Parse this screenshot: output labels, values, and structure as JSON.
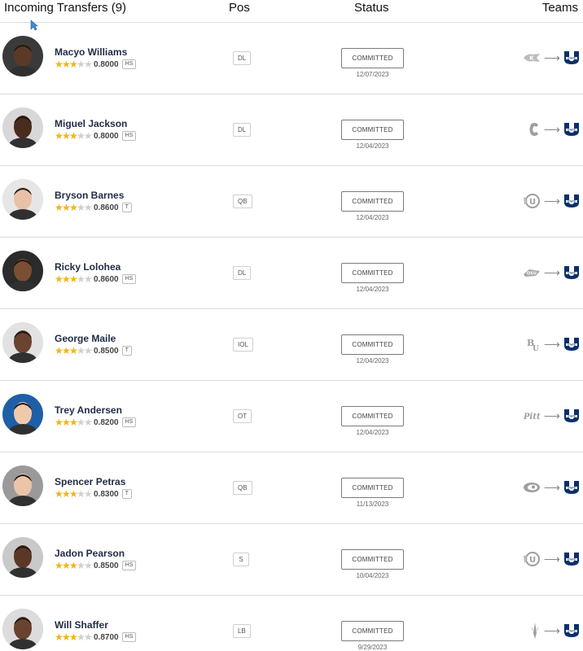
{
  "header": {
    "title": "Incoming Transfers (9)",
    "pos": "Pos",
    "status": "Status",
    "teams": "Teams"
  },
  "colors": {
    "star": "#f2b417",
    "name": "#1f2a44",
    "dest": "#0b2f6b"
  },
  "players": [
    {
      "name": "Macyo Williams",
      "stars": 3,
      "rating": "0.8000",
      "badge": "HS",
      "pos": "DL",
      "status": "COMMITTED",
      "date": "12/07/2023",
      "from_icon": "kent-state-logo-icon",
      "to_icon": "utah-state-logo-icon",
      "skin": "#5a3a26",
      "bg": "#3a3a3a"
    },
    {
      "name": "Miguel Jackson",
      "stars": 3,
      "rating": "0.8000",
      "badge": "HS",
      "pos": "DL",
      "status": "COMMITTED",
      "date": "12/04/2023",
      "from_icon": "charlotte-logo-icon",
      "to_icon": "utah-state-logo-icon",
      "skin": "#4a2c1c",
      "bg": "#d8d8d8"
    },
    {
      "name": "Bryson Barnes",
      "stars": 3,
      "rating": "0.8600",
      "badge": "T",
      "pos": "QB",
      "status": "COMMITTED",
      "date": "12/04/2023",
      "from_icon": "utah-logo-icon",
      "to_icon": "utah-state-logo-icon",
      "skin": "#e8c1a6",
      "bg": "#e6e6e6"
    },
    {
      "name": "Ricky Lolohea",
      "stars": 3,
      "rating": "0.8600",
      "badge": "HS",
      "pos": "DL",
      "status": "COMMITTED",
      "date": "12/04/2023",
      "from_icon": "oklahoma-state-logo-icon",
      "to_icon": "utah-state-logo-icon",
      "skin": "#7a4f34",
      "bg": "#2b2b2b"
    },
    {
      "name": "George Maile",
      "stars": 3,
      "rating": "0.8500",
      "badge": "T",
      "pos": "IOL",
      "status": "COMMITTED",
      "date": "12/04/2023",
      "from_icon": "baylor-logo-icon",
      "to_icon": "utah-state-logo-icon",
      "skin": "#6b4330",
      "bg": "#e2e2e2"
    },
    {
      "name": "Trey Andersen",
      "stars": 3,
      "rating": "0.8200",
      "badge": "HS",
      "pos": "OT",
      "status": "COMMITTED",
      "date": "12/04/2023",
      "from_icon": "pitt-logo-icon",
      "to_icon": "utah-state-logo-icon",
      "skin": "#f0c9ad",
      "bg": "#1f5fa8"
    },
    {
      "name": "Spencer Petras",
      "stars": 3,
      "rating": "0.8300",
      "badge": "T",
      "pos": "QB",
      "status": "COMMITTED",
      "date": "11/13/2023",
      "from_icon": "iowa-logo-icon",
      "to_icon": "utah-state-logo-icon",
      "skin": "#ecc4a8",
      "bg": "#9a9a9a"
    },
    {
      "name": "Jadon Pearson",
      "stars": 3,
      "rating": "0.8500",
      "badge": "HS",
      "pos": "S",
      "status": "COMMITTED",
      "date": "10/04/2023",
      "from_icon": "utah-logo-icon",
      "to_icon": "utah-state-logo-icon",
      "skin": "#5b3826",
      "bg": "#c9c9c9"
    },
    {
      "name": "Will Shaffer",
      "stars": 3,
      "rating": "0.8700",
      "badge": "HS",
      "pos": "LB",
      "status": "COMMITTED",
      "date": "9/29/2023",
      "from_icon": "arizona-state-logo-icon",
      "to_icon": "utah-state-logo-icon",
      "skin": "#6a4230",
      "bg": "#dcdcdc"
    }
  ]
}
